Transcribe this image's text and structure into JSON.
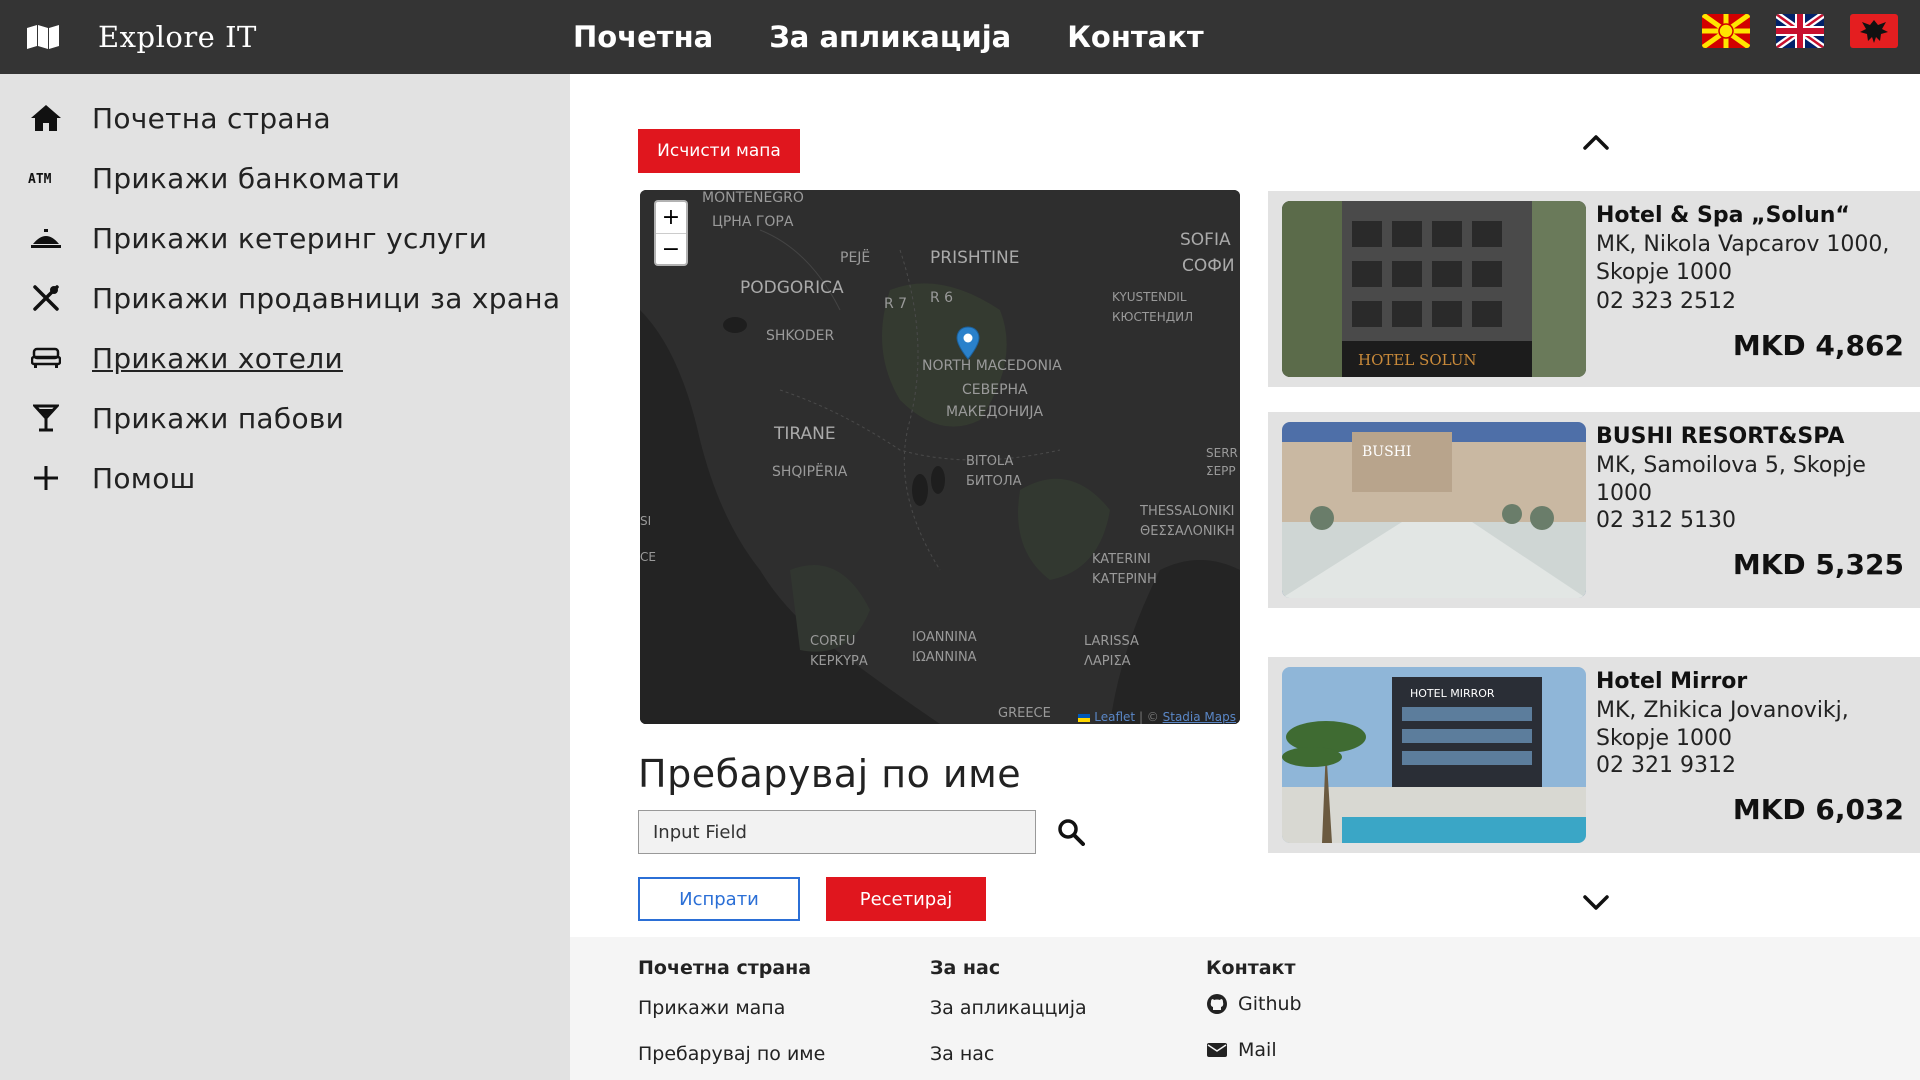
{
  "header": {
    "brand": "Explore IT",
    "nav": [
      "Почетна",
      "За апликација",
      "Контакт"
    ],
    "flags": [
      "flag-macedonia-icon",
      "flag-uk-icon",
      "flag-albania-icon"
    ]
  },
  "sidebar": {
    "items": [
      {
        "label": "Почетна страна",
        "icon": "home-icon"
      },
      {
        "label": "Прикажи банкомати",
        "icon": "atm-icon"
      },
      {
        "label": "Прикажи кетеринг услуги",
        "icon": "catering-icon"
      },
      {
        "label": "Прикажи продавници за храна",
        "icon": "utensils-icon"
      },
      {
        "label": "Прикажи хотели",
        "icon": "bed-icon",
        "active": true
      },
      {
        "label": "Прикажи пабови",
        "icon": "cocktail-icon"
      },
      {
        "label": "Помош",
        "icon": "plus-icon"
      }
    ]
  },
  "map": {
    "clear_label": "Исчисти мапа",
    "zoom_in": "+",
    "zoom_out": "−",
    "labels": {
      "montenegro": "MONTENEGRO",
      "crna_gora": "ЦРНА ГОРА",
      "peje": "PEJË",
      "prishtine": "PRISHTINE",
      "sofia": "SOFIA",
      "sofia_cyr": "СОФИ",
      "podgorica": "PODGORICA",
      "r7": "R 7",
      "r6": "R 6",
      "kyustendil": "KYUSTENDIL",
      "kyustendil_cyr": "КЮСТЕНДИЛ",
      "shkoder": "SHKODER",
      "north_macedonia": "NORTH MACEDONIA",
      "severna": "СЕВЕРНА",
      "makedonija": "МАКЕДОНИЈА",
      "tirane": "TIRANE",
      "shqiperia": "SHQIPËRIA",
      "bitola": "BITOLA",
      "bitola_cyr": "БИТОЛА",
      "serr": "SERR",
      "serr_cyr": "ΣΕΡΡ",
      "thessaloniki": "THESSALONIKI",
      "thessaloniki_gr": "ΘΕΣΣΑΛΟΝΙΚΗ",
      "katerini": "KATERINI",
      "katerini_gr": "ΚΑΤΕΡΙΝΗ",
      "si": "SI",
      "ce": "CE",
      "corfu": "CORFU",
      "kerkyra": "ΚΕΡΚΥΡΑ",
      "ioannina": "IOANNINA",
      "ioannina_gr": "ΙΩΑΝΝΙΝΑ",
      "larissa": "LARISSA",
      "larissa_gr": "ΛΑΡΙΣΑ",
      "greece": "GREECE"
    },
    "attribution_leaflet": "Leaflet",
    "attribution_sep": " | © ",
    "attribution_stadia": "Stadia Maps"
  },
  "search": {
    "title": "Пребарувај по име",
    "input_value": "Input Field",
    "send_label": "Испрати",
    "reset_label": "Ресетирај"
  },
  "hotels": [
    {
      "name": "Hotel & Spa „Solun“",
      "address": "MK, Nikola Vapcarov 1000, Skopje 1000",
      "phone": "02 323 2512",
      "price": "MKD 4,862",
      "sign": "HOTEL SOLUN"
    },
    {
      "name": "BUSHI RESORT&SPA",
      "address": "MK, Samoilova 5, Skopje 1000",
      "phone": "02 312 5130",
      "price": "MKD 5,325",
      "sign": "BUSHI"
    },
    {
      "name": "Hotel Mirror",
      "address": "MK, Zhikica Jovanovikj, Skopje 1000",
      "phone": "02 321 9312",
      "price": "MKD 6,032",
      "sign": "HOTEL MIRROR"
    }
  ],
  "footer": {
    "col1": {
      "head": "Почетна страна",
      "links": [
        "Прикажи мапа",
        "Пребарувај по име"
      ]
    },
    "col2": {
      "head": "За нас",
      "links": [
        "За апликацција",
        "За нас"
      ]
    },
    "col3": {
      "head": "Контакт",
      "links": [
        "Github",
        "Mail"
      ]
    }
  },
  "colors": {
    "accent_red": "#e0161e",
    "navbar": "#343434",
    "sidebar": "#e2e2e2",
    "link_blue": "#2b6fd6"
  }
}
